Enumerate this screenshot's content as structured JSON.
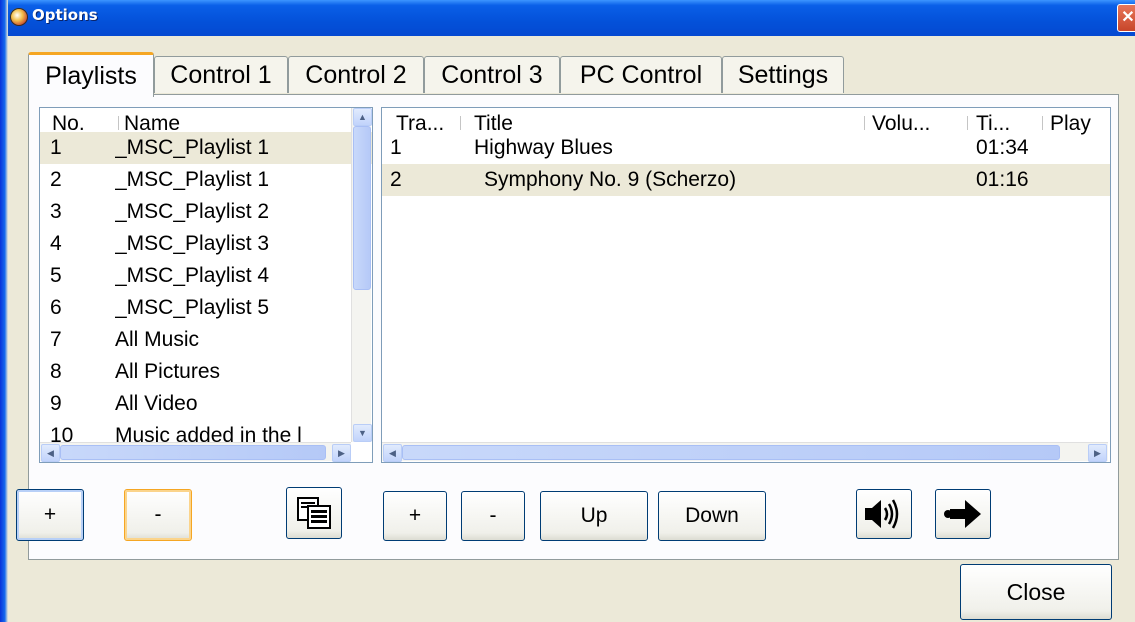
{
  "window": {
    "title": "Options",
    "close_glyph": "✕",
    "app_icon": "app-logo-icon"
  },
  "tabs": [
    {
      "label": "Playlists",
      "active": true
    },
    {
      "label": "Control 1",
      "active": false
    },
    {
      "label": "Control 2",
      "active": false
    },
    {
      "label": "Control 3",
      "active": false
    },
    {
      "label": "PC Control",
      "active": false
    },
    {
      "label": "Settings",
      "active": false
    }
  ],
  "playlists": {
    "columns": [
      "No.",
      "Name"
    ],
    "rows": [
      {
        "no": "1",
        "name": "_MSC_Playlist 1",
        "selected": true
      },
      {
        "no": "2",
        "name": "_MSC_Playlist 1",
        "selected": false
      },
      {
        "no": "3",
        "name": "_MSC_Playlist 2",
        "selected": false
      },
      {
        "no": "4",
        "name": "_MSC_Playlist 3",
        "selected": false
      },
      {
        "no": "5",
        "name": "_MSC_Playlist 4",
        "selected": false
      },
      {
        "no": "6",
        "name": "_MSC_Playlist 5",
        "selected": false
      },
      {
        "no": "7",
        "name": "All Music",
        "selected": false
      },
      {
        "no": "8",
        "name": "All Pictures",
        "selected": false
      },
      {
        "no": "9",
        "name": "All Video",
        "selected": false
      },
      {
        "no": "10",
        "name": "Music added in the l",
        "selected": false
      }
    ]
  },
  "tracks": {
    "columns": [
      "Tra...",
      "Title",
      "Volu...",
      "Ti...",
      "Play"
    ],
    "rows": [
      {
        "track": "1",
        "title": "Highway Blues",
        "volume": "",
        "time": "01:34",
        "play": "",
        "selected": false
      },
      {
        "track": "2",
        "title": "Symphony No. 9 (Scherzo)",
        "volume": "",
        "time": "01:16",
        "play": "",
        "selected": true
      }
    ]
  },
  "playlist_buttons": {
    "add": "+",
    "remove": "-",
    "copy_icon": "copy-icon"
  },
  "track_buttons": {
    "add": "+",
    "remove": "-",
    "up": "Up",
    "down": "Down",
    "volume_icon": "speaker-icon",
    "play_icon": "play-arrow-icon"
  },
  "footer": {
    "close": "Close"
  },
  "scroll": {
    "up": "▲",
    "down": "▼",
    "left": "◀",
    "right": "▶"
  },
  "colors": {
    "titlebar": "#0451d9",
    "accent_tab": "#f5a623",
    "selection": "#ECE9D8"
  }
}
